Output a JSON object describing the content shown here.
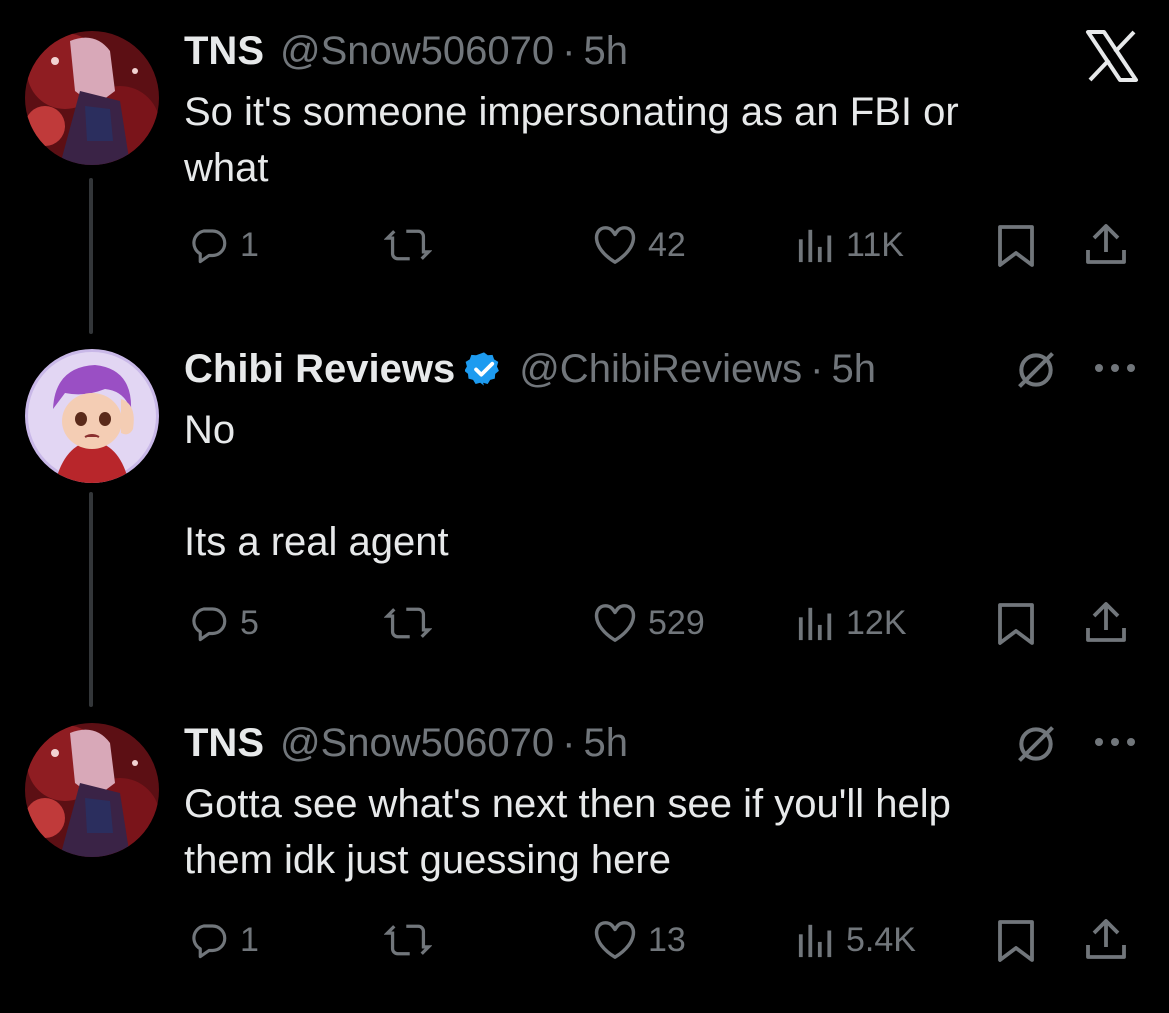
{
  "tweets": [
    {
      "name": "TNS",
      "handle": "@Snow506070",
      "separator": "·",
      "time": "5h",
      "verified": false,
      "text": "So it's someone impersonating as an FBI or\nwhat",
      "replies": "1",
      "retweets": "",
      "likes": "42",
      "views": "11K"
    },
    {
      "name": "Chibi Reviews",
      "handle": "@ChibiReviews",
      "separator": "·",
      "time": "5h",
      "verified": true,
      "text": "No\n\nIts a real agent",
      "replies": "5",
      "retweets": "",
      "likes": "529",
      "views": "12K"
    },
    {
      "name": "TNS",
      "handle": "@Snow506070",
      "separator": "·",
      "time": "5h",
      "verified": false,
      "text": "Gotta see what's next then see if you'll help\nthem idk just guessing here",
      "replies": "1",
      "retweets": "",
      "likes": "13",
      "views": "5.4K"
    }
  ],
  "icons": {
    "top_right": "x-logo-icon",
    "tweet_menu": "more-options-icon",
    "grok": "grok-icon",
    "reply": "reply-icon",
    "retweet": "retweet-icon",
    "like": "heart-icon",
    "views": "views-icon",
    "bookmark": "bookmark-icon",
    "share": "share-icon"
  },
  "colors": {
    "background": "#000000",
    "text_primary": "#e7e9ea",
    "text_secondary": "#71767b",
    "verified": "#1d9bf0",
    "thread_line": "#333639"
  }
}
